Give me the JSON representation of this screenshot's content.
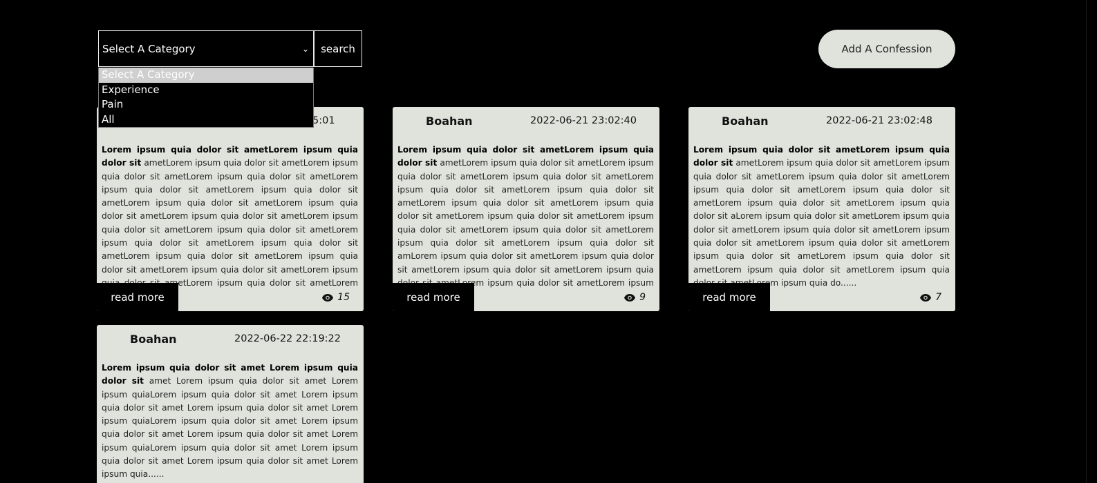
{
  "toolbar": {
    "select_value": "Select A Category",
    "search_label": "search",
    "add_label": "Add A Confession"
  },
  "dropdown": {
    "options": [
      "Select A Category",
      "Experience",
      "Pain",
      "All"
    ]
  },
  "cards": [
    {
      "author": "",
      "date": "5:01",
      "lead": "Lorem ipsum quia dolor sit ametLorem ipsum quia dolor sit",
      "body": "ametLorem ipsum quia dolor sit ametLorem ipsum quia dolor sit ametLorem ipsum quia dolor sit ametLorem ipsum quia dolor sit ametLorem ipsum quia dolor sit ametLorem ipsum quia dolor sit ametLorem ipsum quia dolor sit ametLorem ipsum quia dolor sit ametLorem ipsum quia dolor sit ametLorem ipsum quia dolor sit ametLorem ipsum quia dolor sit ametLorem ipsum quia dolor sit ametLorem ipsum quia dolor sit ametLorem ipsum quia dolor sit ametLorem ipsum quia dolor sit ametLorem ipsum quia dolor sit ametLorem ipsum quia dolor sit ametLorem ipsum quia......",
      "read_more": "read more",
      "views": "15"
    },
    {
      "author": "Boahan",
      "date": "2022-06-21 23:02:40",
      "lead": "Lorem ipsum quia dolor sit ametLorem ipsum quia dolor sit",
      "body": "ametLorem ipsum quia dolor sit ametLorem ipsum quia dolor sit ametLorem ipsum quia dolor sit ametLorem ipsum quia dolor sit ametLorem ipsum quia dolor sit ametLorem ipsum quia dolor sit ametLorem ipsum quia dolor sit ametLorem ipsum quia dolor sit ametLorem ipsum quia dolor sit ametLorem ipsum quia dolor sit ametLorem ipsum quia dolor sit ametLorem ipsum quia dolor sit amLorem ipsum quia dolor sit ametLorem ipsum quia dolor sit ametLorem ipsum quia dolor sit ametLorem ipsum quia dolor sit ametLorem ipsum quia dolor sit ametLorem ipsum quia d......",
      "read_more": "read more",
      "views": "9"
    },
    {
      "author": "Boahan",
      "date": "2022-06-21 23:02:48",
      "lead": "Lorem ipsum quia dolor sit ametLorem ipsum quia dolor sit",
      "body": "ametLorem ipsum quia dolor sit ametLorem ipsum quia dolor sit ametLorem ipsum quia dolor sit ametLorem ipsum quia dolor sit ametLorem ipsum quia dolor sit ametLorem ipsum quia dolor sit ametLorem ipsum quia dolor sit aLorem ipsum quia dolor sit ametLorem ipsum quia dolor sit ametLorem ipsum quia dolor sit ametLorem ipsum quia dolor sit ametLorem ipsum quia dolor sit ametLorem ipsum quia dolor sit ametLorem ipsum quia dolor sit ametLorem ipsum quia dolor sit ametLorem ipsum quia dolor sit ametLorem ipsum quia do......",
      "read_more": "read more",
      "views": "7"
    },
    {
      "author": "Boahan",
      "date": "2022-06-22 22:19:22",
      "lead": "Lorem ipsum quia dolor sit amet Lorem ipsum quia dolor sit",
      "body": "amet Lorem ipsum quia dolor sit amet Lorem ipsum quiaLorem ipsum quia dolor sit amet Lorem ipsum quia dolor sit amet Lorem ipsum quia dolor sit amet Lorem ipsum quiaLorem ipsum quia dolor sit amet Lorem ipsum quia dolor sit amet Lorem ipsum quia dolor sit amet Lorem ipsum quiaLorem ipsum quia dolor sit amet Lorem ipsum quia dolor sit amet Lorem ipsum quia dolor sit amet Lorem ipsum quia......",
      "read_more": "",
      "views": ""
    }
  ]
}
